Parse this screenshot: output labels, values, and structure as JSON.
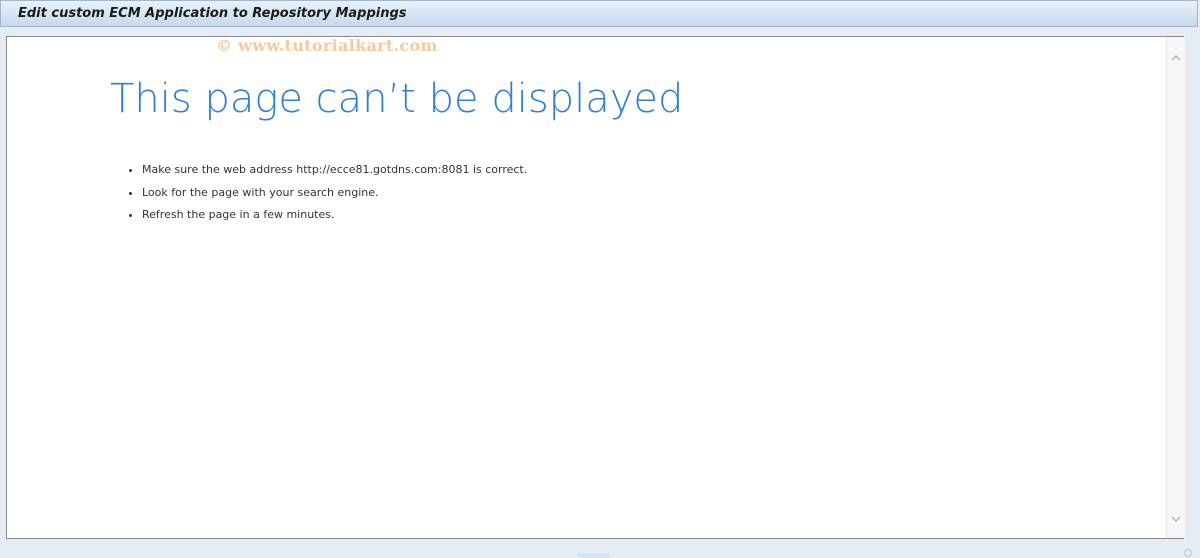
{
  "window": {
    "title": "Edit custom ECM Application to Repository Mappings"
  },
  "watermark": {
    "text": "© www.tutorialkart.com"
  },
  "error_page": {
    "heading": "This page can’t be displayed",
    "suggestions": [
      "Make sure the web address http://ecce81.gotdns.com:8081 is correct.",
      "Look for the page with your search engine.",
      "Refresh the page in a few minutes."
    ]
  },
  "scrollbar": {
    "up_icon": "chevron-up-icon",
    "down_icon": "chevron-down-icon"
  },
  "colors": {
    "heading": "#2f7fd8",
    "title_bar": "#d7e4f1",
    "watermark": "#f7c89a"
  }
}
